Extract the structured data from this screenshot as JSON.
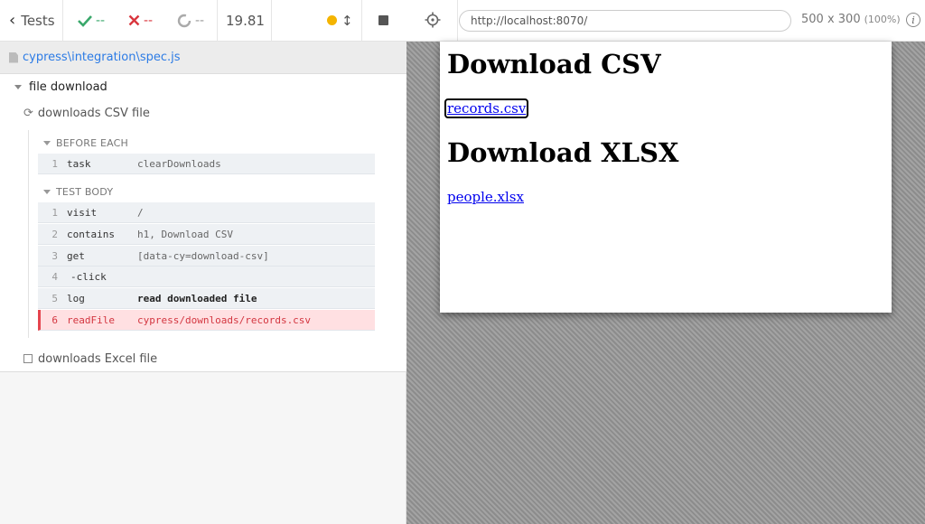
{
  "reporter": {
    "tests_label": "Tests",
    "passed_count": "--",
    "failed_count": "--",
    "pending_count": "--",
    "duration": "19.81",
    "spec_path": "cypress\\integration\\spec.js",
    "suite_title": "file download",
    "tests": [
      {
        "title": "downloads CSV file",
        "state": "running",
        "hooks": [
          {
            "title": "BEFORE EACH",
            "commands": [
              {
                "num": "1",
                "name": "task",
                "message": "clearDownloads"
              }
            ]
          },
          {
            "title": "TEST BODY",
            "commands": [
              {
                "num": "1",
                "name": "visit",
                "message": "/"
              },
              {
                "num": "2",
                "name": "contains",
                "message": "h1, Download CSV"
              },
              {
                "num": "3",
                "name": "get",
                "message": "[data-cy=download-csv]"
              },
              {
                "num": "4",
                "name": "-click",
                "message": ""
              },
              {
                "num": "5",
                "name": "log",
                "message": "read downloaded file"
              },
              {
                "num": "6",
                "name": "readFile",
                "message": "cypress/downloads/records.csv",
                "state": "failed"
              }
            ]
          }
        ]
      },
      {
        "title": "downloads Excel file",
        "state": "pending"
      }
    ]
  },
  "aut": {
    "url": "http://localhost:8070/",
    "viewport_size": "500 x 300",
    "viewport_scale": "(100%)",
    "info_glyph": "i",
    "page": {
      "heading_csv": "Download CSV",
      "link_csv": "records.csv",
      "heading_xlsx": "Download XLSX",
      "link_xlsx": "people.xlsx"
    }
  },
  "colors": {
    "passed": "#3aa86b",
    "failed": "#d9363e",
    "link": "#2c7be5",
    "running_dot": "#f4b400",
    "failed_row_bg": "#ffe0e2"
  }
}
